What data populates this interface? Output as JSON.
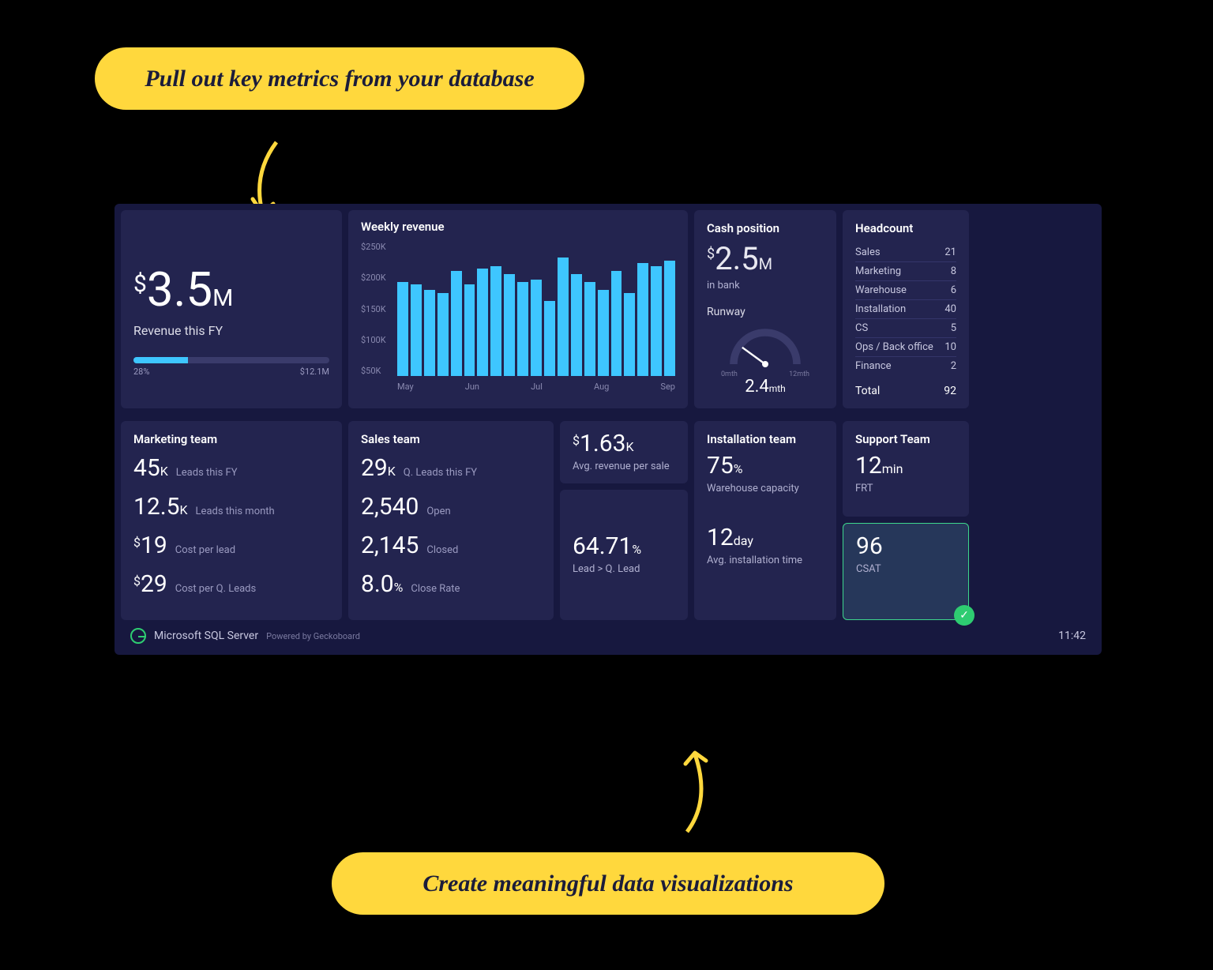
{
  "annotations": {
    "top": "Pull out key metrics from your database",
    "bottom": "Create meaningful data visualizations"
  },
  "revenue_fy": {
    "prefix": "$",
    "value": "3.5",
    "suffix": "M",
    "label": "Revenue this FY",
    "progress_pct": "28%",
    "progress_pct_num": 28,
    "target": "$12.1M"
  },
  "chart_data": {
    "type": "bar",
    "title": "Weekly revenue",
    "y_ticks": [
      "$250K",
      "$200K",
      "$150K",
      "$100K",
      "$50K"
    ],
    "ylim": [
      0,
      250
    ],
    "x_ticks": [
      "May",
      "Jun",
      "Jul",
      "Aug",
      "Sep"
    ],
    "values": [
      175,
      170,
      160,
      155,
      195,
      170,
      200,
      205,
      190,
      175,
      180,
      140,
      220,
      190,
      175,
      160,
      195,
      155,
      210,
      205,
      215
    ]
  },
  "cash": {
    "title": "Cash position",
    "prefix": "$",
    "value": "2.5",
    "suffix": "M",
    "sub": "in bank",
    "runway_label": "Runway",
    "gauge_min": "0mth",
    "gauge_max": "12mth",
    "runway_value": "2.4",
    "runway_unit": "mth",
    "gauge_fraction": 0.2
  },
  "headcount": {
    "title": "Headcount",
    "rows": [
      {
        "label": "Sales",
        "value": "21"
      },
      {
        "label": "Marketing",
        "value": "8"
      },
      {
        "label": "Warehouse",
        "value": "6"
      },
      {
        "label": "Installation",
        "value": "40"
      },
      {
        "label": "CS",
        "value": "5"
      },
      {
        "label": "Ops / Back office",
        "value": "10"
      },
      {
        "label": "Finance",
        "value": "2"
      }
    ],
    "total_label": "Total",
    "total_value": "92"
  },
  "marketing": {
    "title": "Marketing team",
    "metrics": [
      {
        "prefix": "",
        "value": "45",
        "suffix": "K",
        "label": "Leads this FY"
      },
      {
        "prefix": "",
        "value": "12.5",
        "suffix": "K",
        "label": "Leads this month"
      },
      {
        "prefix": "$",
        "value": "19",
        "suffix": "",
        "label": "Cost per lead"
      },
      {
        "prefix": "$",
        "value": "29",
        "suffix": "",
        "label": "Cost per Q. Leads"
      }
    ]
  },
  "sales": {
    "title": "Sales team",
    "metrics": [
      {
        "prefix": "",
        "value": "29",
        "suffix": "K",
        "label": "Q. Leads this FY"
      },
      {
        "prefix": "",
        "value": "2,540",
        "suffix": "",
        "label": "Open"
      },
      {
        "prefix": "",
        "value": "2,145",
        "suffix": "",
        "label": "Closed"
      },
      {
        "prefix": "",
        "value": "8.0",
        "suffix": "%",
        "label": "Close Rate"
      }
    ]
  },
  "avg_rev": {
    "prefix": "$",
    "value": "1.63",
    "suffix": "K",
    "label": "Avg. revenue per sale"
  },
  "lead_conv": {
    "value": "64.71",
    "suffix": "%",
    "label": "Lead > Q. Lead"
  },
  "installation": {
    "title": "Installation team",
    "cap_value": "75",
    "cap_suffix": "%",
    "cap_label": "Warehouse capacity",
    "time_value": "12",
    "time_suffix": "day",
    "time_label": "Avg. installation time"
  },
  "support": {
    "title": "Support Team",
    "frt_value": "12",
    "frt_suffix": "min",
    "frt_label": "FRT",
    "csat_value": "96",
    "csat_label": "CSAT"
  },
  "footer": {
    "source": "Microsoft SQL Server",
    "powered": "Powered by Geckoboard",
    "time": "11:42"
  }
}
